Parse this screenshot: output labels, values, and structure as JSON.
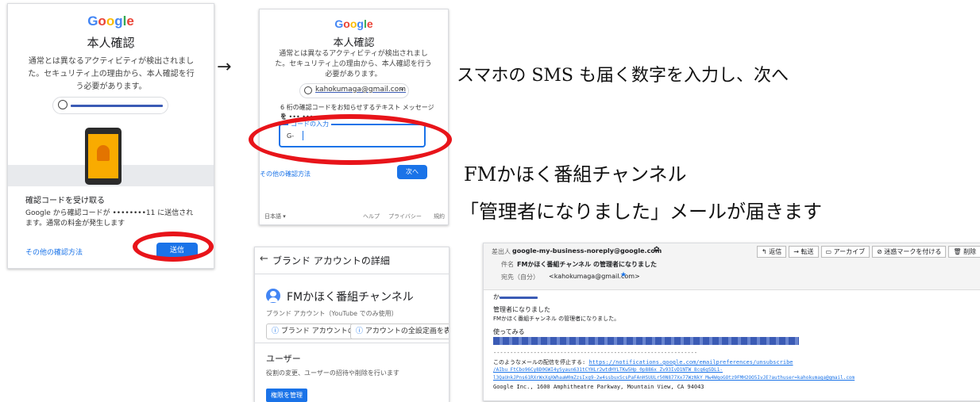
{
  "panel1": {
    "logo": "Google",
    "title": "本人確認",
    "description": "通常とは異なるアクティビティが検出されました。セキュリティ上の理由から、本人確認を行う必要があります。",
    "section_heading": "確認コードを受け取る",
    "send_info": "Google から確認コードが ••••••••11 に送信されます。通常の料金が発生します",
    "other_methods": "その他の確認方法",
    "send_button": "送信"
  },
  "arrow": "→",
  "panel2": {
    "logo": "Google",
    "title": "本人確認",
    "description": "通常とは異なるアクティビティが検出されました。セキュリティ上の理由から、本人確認を行う必要があります。",
    "email": "kahokumaga@gmail.com",
    "sms_info": "6 桁の確認コードをお知らせするテキスト メッセージを",
    "sms_info_cont": "を ••• •••",
    "field_label": "コードの入力",
    "field_prefix": "G-",
    "other_methods": "その他の確認方法",
    "next_button": "次へ",
    "footer_lang": "日本語",
    "footer_help": "ヘルプ",
    "footer_privacy": "プライバシー",
    "footer_terms": "規約"
  },
  "annotations": {
    "sms_instruction": "スマホの SMS も届く数字を入力し、次へ",
    "channel_name": "FMかほく番組チャンネル",
    "admin_notice": "「管理者になりました」メールが届きます"
  },
  "panel3": {
    "header": "ブランド アカウントの詳細",
    "channel_name": "FMかほく番組チャンネル",
    "subtitle": "ブランド アカウント（YouTube でのみ使用）",
    "chip1": "ブランド アカウントの詳細",
    "chip2": "アカウントの全設定画を表示",
    "users_heading": "ユーザー",
    "users_desc": "役割の変更、ユーザーの招待や削除を行います",
    "manage_button": "権限を管理"
  },
  "panel4": {
    "from_label": "差出人",
    "from_value": "google-my-business-noreply@google.com",
    "subject_label": "件名",
    "subject_value": "FMかほく番組チャンネル の管理者になりました",
    "to_label": "宛先（自分）",
    "to_value": "<kahokumaga@gmail.com>",
    "toolbar": [
      "返信",
      "転送",
      "アーカイブ",
      "迷惑マークを付ける",
      "削除"
    ],
    "greeting": "か",
    "body_line1": "管理者になりました",
    "body_line2": "FMかほく番組チャンネル の管理者になりました。",
    "try_heading": "使ってみる",
    "divider": "-------------------------------------------------------------",
    "unsubscribe_prefix": "このようなメールの配信を停止する:",
    "unsubscribe_link1": "https://notifications.google.com/emailpreferences/unsubscribe",
    "unsubscribe_link2": "/AIbu_FtCbo96Cy8D0GWI4ySyaun631tCYHLr2wtdHYLTKw5Hp_0p886x_Zv93IvD1NTW_8cq6gSDL1-",
    "unsubscribe_link3": "l3QaUnkJPns61RXrWxXqXWhaaW0mZzsIxg9-2w4ssbuxScsPaFAnHSUULr50N877Xx77WzNkY_Mw4WqoGOtz9FMH2OO5IvJE?authuser=kahokumaga@gmail.com",
    "address": "Google Inc., 1600 Amphitheatre Parkway, Mountain View, CA 94043"
  }
}
